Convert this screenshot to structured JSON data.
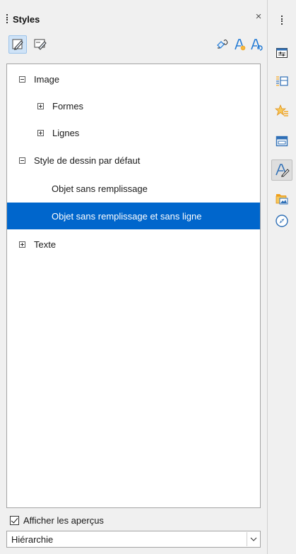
{
  "deck": {
    "title": "Styles",
    "close_glyph": "×"
  },
  "toolbar": {
    "left": [
      {
        "icon": "drawing-styles-icon",
        "active": true
      },
      {
        "icon": "presentation-styles-icon",
        "active": false
      }
    ],
    "right": [
      {
        "icon": "fill-format-mode-icon"
      },
      {
        "icon": "new-style-from-selection-icon"
      },
      {
        "icon": "update-style-icon"
      }
    ]
  },
  "tree": {
    "rows": [
      {
        "label": "Image",
        "level": 0,
        "expander": "minus",
        "selected": false
      },
      {
        "label": "Formes",
        "level": 1,
        "expander": "plus",
        "selected": false
      },
      {
        "label": "Lignes",
        "level": 1,
        "expander": "plus",
        "selected": false
      },
      {
        "label": "Style de dessin par défaut",
        "level": 0,
        "expander": "minus",
        "selected": false
      },
      {
        "label": "Objet sans remplissage",
        "level": 2,
        "expander": "none",
        "selected": false
      },
      {
        "label": "Objet sans remplissage et sans ligne",
        "level": 2,
        "expander": "none",
        "selected": true
      },
      {
        "label": "Texte",
        "level": 0,
        "expander": "plus",
        "selected": false
      }
    ]
  },
  "preview": {
    "label": "Afficher les aperçus",
    "checked": true
  },
  "filter": {
    "value": "Hiérarchie"
  },
  "tabbar": {
    "tabs": [
      {
        "icon": "properties-icon",
        "active": false
      },
      {
        "icon": "slide-transition-icon",
        "active": false
      },
      {
        "icon": "animation-icon",
        "active": false
      },
      {
        "icon": "master-slides-icon",
        "active": false
      },
      {
        "icon": "styles-icon",
        "active": true
      },
      {
        "icon": "gallery-icon",
        "active": false
      },
      {
        "icon": "navigator-icon",
        "active": false
      }
    ]
  },
  "colors": {
    "selection": "#0066cc",
    "accent_blue": "#1e78d4",
    "accent_orange": "#f2a21b"
  }
}
